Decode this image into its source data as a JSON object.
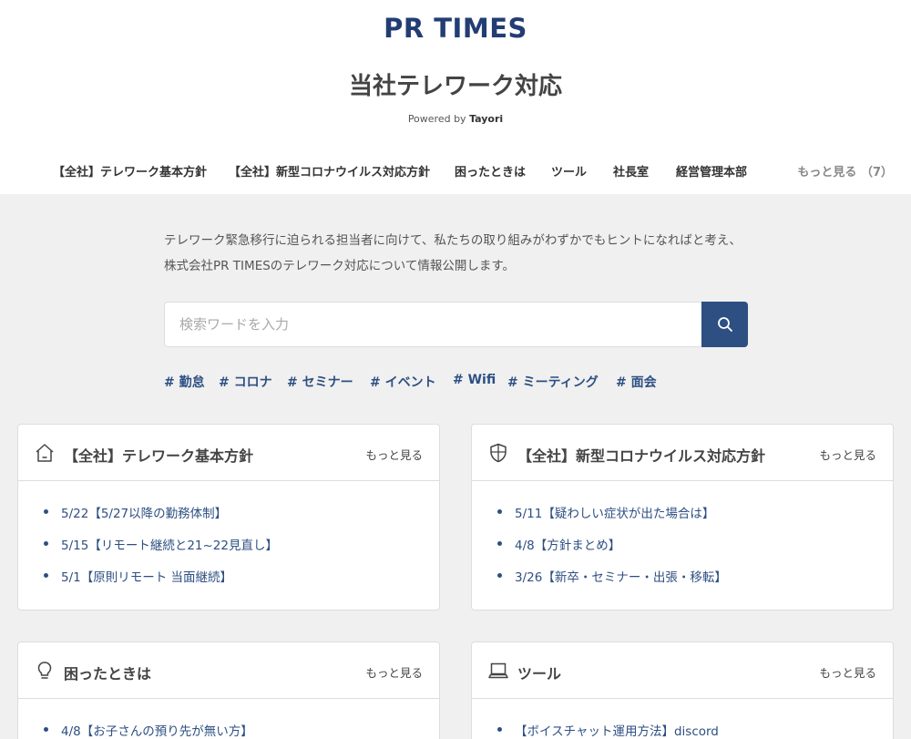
{
  "header": {
    "logo": "PR TIMES",
    "site_title": "当社テレワーク対応",
    "powered_prefix": "Powered by ",
    "powered_brand": "Tayori"
  },
  "nav": {
    "items": [
      {
        "label": "【全社】テレワーク基本方針"
      },
      {
        "label": "【全社】新型コロナウイルス対応方針"
      },
      {
        "label": "困ったときは"
      },
      {
        "label": "ツール"
      },
      {
        "label": "社長室"
      },
      {
        "label": "経営管理本部"
      }
    ],
    "more_label": "もっと見る （7）"
  },
  "intro": {
    "text": "テレワーク緊急移行に迫られる担当者に向けて、私たちの取り組みがわずかでもヒントになればと考え、株式会社PR TIMESのテレワーク対応について情報公開します。"
  },
  "search": {
    "placeholder": "検索ワードを入力",
    "icon": "search-icon"
  },
  "tags": [
    "# 勤怠",
    "# コロナ",
    "# セミナー",
    "# イベント",
    "# Wifi",
    "# ミーティング",
    "# 面会"
  ],
  "cards": [
    {
      "icon": "home-icon",
      "title": "【全社】テレワーク基本方針",
      "more": "もっと見る",
      "items": [
        "5/22【5/27以降の勤務体制】",
        "5/15【リモート継続と21~22見直し】",
        "5/1【原則リモート 当面継続】"
      ]
    },
    {
      "icon": "shield-icon",
      "title": "【全社】新型コロナウイルス対応方針",
      "more": "もっと見る",
      "items": [
        "5/11【疑わしい症状が出た場合は】",
        "4/8【方針まとめ】",
        "3/26【新卒・セミナー・出張・移転】"
      ]
    },
    {
      "icon": "lightbulb-icon",
      "title": "困ったときは",
      "more": "もっと見る",
      "items": [
        "4/8【お子さんの預り先が無い方】"
      ]
    },
    {
      "icon": "laptop-icon",
      "title": "ツール",
      "more": "もっと見る",
      "items": [
        "【ボイスチャット運用方法】discord"
      ]
    }
  ],
  "colors": {
    "brand": "#233d74",
    "accent": "#2d4f82",
    "background": "#f0f0f0"
  }
}
